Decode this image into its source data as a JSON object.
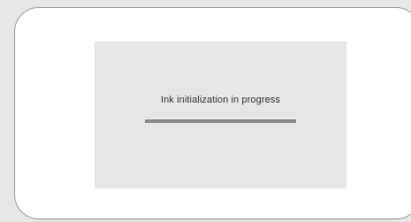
{
  "status": {
    "message": "Ink initialization in progress",
    "progress_fraction": 1.0
  },
  "colors": {
    "background": "#e7e7e7",
    "frame": "#ffffff",
    "dialog": "#e6e6e6",
    "progress_fill": "#8a8a8a"
  }
}
